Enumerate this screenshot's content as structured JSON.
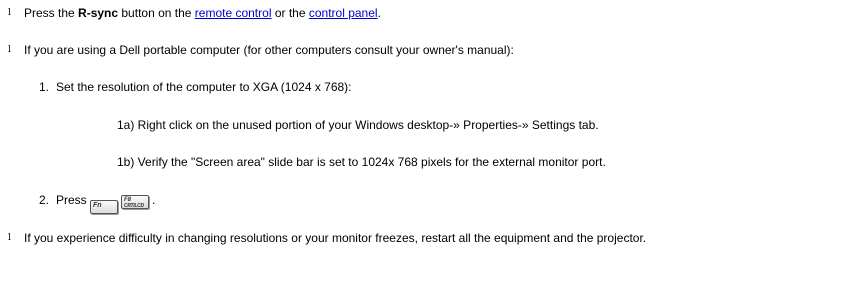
{
  "items": [
    {
      "bullet": "l",
      "text_before": "Press the ",
      "bold": "R-sync",
      "text_mid": " button on the ",
      "link1": "remote control",
      "text_or": " or the ",
      "link2": "control panel",
      "text_end": "."
    },
    {
      "bullet": "l",
      "text": "If you are using a Dell portable computer (for other computers consult your owner's manual):"
    },
    {
      "bullet": "l",
      "text": "If you experience difficulty in changing resolutions or your monitor freezes, restart all the equipment and the projector."
    }
  ],
  "steps": [
    {
      "number": "1.",
      "text": "Set the resolution of the computer to XGA (1024 x 768):"
    },
    {
      "number": "2.",
      "text_before": "Press ",
      "text_end": "."
    }
  ],
  "substeps": [
    {
      "text": "1a) Right click on the unused portion of your Windows desktop-» Properties-» Settings tab."
    },
    {
      "text": "1b) Verify the \"Screen area\" slide bar is set to 1024x 768 pixels for the external monitor port."
    }
  ],
  "keys": {
    "fn_label": "Fn",
    "f8_top": "F8",
    "f8_bottom": "CRT/LCD"
  }
}
